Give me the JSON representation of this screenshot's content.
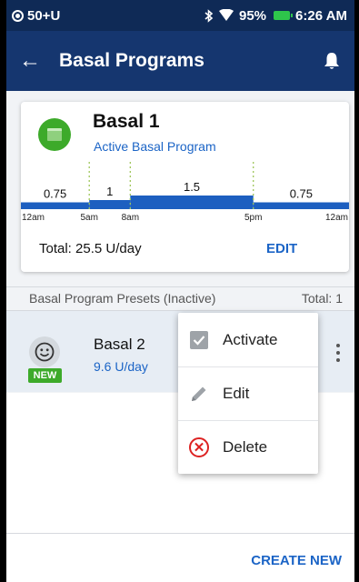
{
  "status_bar": {
    "pod_status": "50+U",
    "battery": "95%",
    "time": "6:26 AM",
    "icons": [
      "pod-icon",
      "bluetooth-icon",
      "wifi-icon",
      "battery-icon"
    ],
    "battery_color": "#2ec54b"
  },
  "app_bar": {
    "title": "Basal Programs",
    "back_icon": "arrow-left-icon",
    "notifications_icon": "bell-icon"
  },
  "active_program": {
    "name": "Basal 1",
    "subtitle": "Active Basal Program",
    "icon": "calendar-icon",
    "total": "Total: 25.5 U/day",
    "edit_label": "EDIT"
  },
  "chart_data": {
    "type": "bar",
    "segments": [
      {
        "start": "12am",
        "end": "5am",
        "rate": 0.75,
        "label": "0.75"
      },
      {
        "start": "5am",
        "end": "8am",
        "rate": 1,
        "label": "1"
      },
      {
        "start": "8am",
        "end": "5pm",
        "rate": 1.5,
        "label": "1.5"
      },
      {
        "start": "5pm",
        "end": "12am",
        "rate": 0.75,
        "label": "0.75"
      }
    ],
    "x_hours": [
      0,
      5,
      8,
      17,
      24
    ],
    "tick_labels": [
      "12am",
      "5am",
      "8am",
      "5pm",
      "12am"
    ],
    "color": "#1d5fc0"
  },
  "presets": {
    "header": "Basal Program Presets (Inactive)",
    "count": "Total: 1",
    "items": [
      {
        "name": "Basal 2",
        "rate": "9.6 U/day",
        "badge": "NEW",
        "icon": "smiley-icon"
      }
    ]
  },
  "menu": {
    "items": [
      {
        "label": "Activate",
        "icon": "checkbox-icon"
      },
      {
        "label": "Edit",
        "icon": "pencil-icon"
      },
      {
        "label": "Delete",
        "icon": "delete-x-icon"
      }
    ]
  },
  "actions": {
    "create_new": "CREATE NEW"
  }
}
